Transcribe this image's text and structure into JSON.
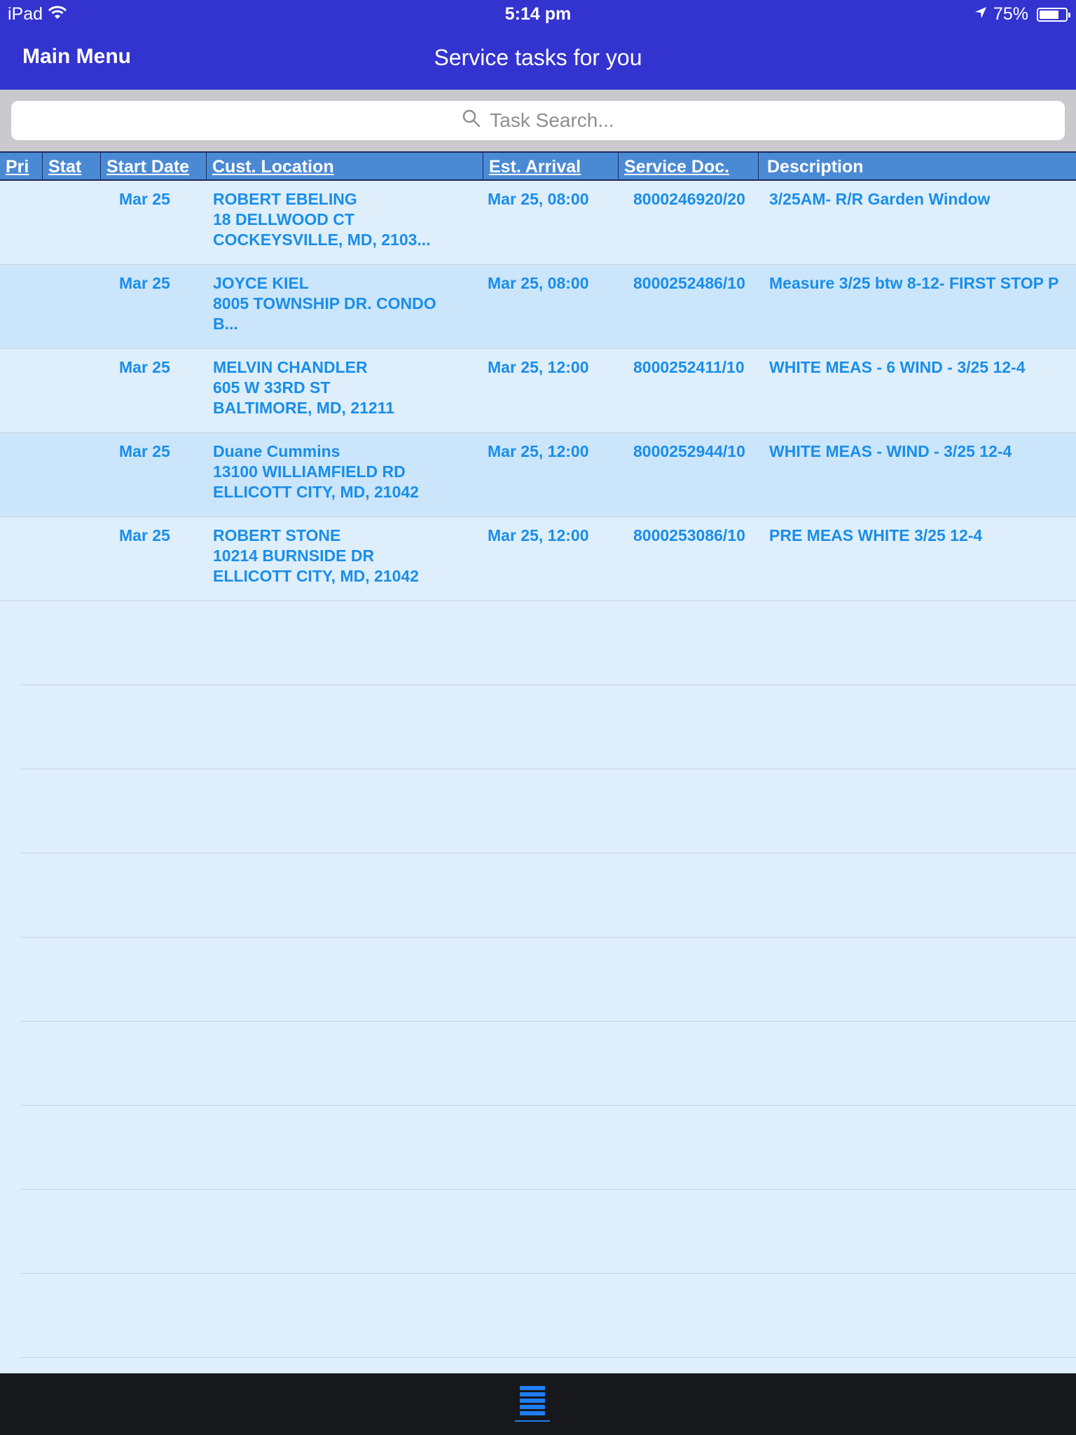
{
  "status_bar": {
    "device": "iPad",
    "time": "5:14 pm",
    "battery": "75%",
    "battery_level": 0.75
  },
  "nav": {
    "back_label": "Main Menu",
    "title": "Service tasks for you"
  },
  "search": {
    "placeholder": "Task Search..."
  },
  "table": {
    "headers": {
      "pri": "Pri",
      "stat": "Stat",
      "start_date": "Start Date",
      "location": "Cust. Location",
      "arrival": "Est. Arrival",
      "doc": "Service Doc.",
      "description": "Description"
    },
    "rows": [
      {
        "start_date": "Mar 25",
        "name": "ROBERT EBELING",
        "address1": "18 DELLWOOD CT",
        "address2": "COCKEYSVILLE, MD, 2103...",
        "arrival": "Mar 25, 08:00",
        "doc": "8000246920/20",
        "description": "3/25AM- R/R Garden Window"
      },
      {
        "start_date": "Mar 25",
        "name": "JOYCE KIEL",
        "address1": "8005 TOWNSHIP DR. CONDO",
        "address2": "B...",
        "arrival": "Mar 25, 08:00",
        "doc": "8000252486/10",
        "description": "Measure 3/25 btw 8-12- FIRST STOP P"
      },
      {
        "start_date": "Mar 25",
        "name": "MELVIN CHANDLER",
        "address1": "605 W 33RD ST",
        "address2": "BALTIMORE, MD, 21211",
        "arrival": "Mar 25, 12:00",
        "doc": "8000252411/10",
        "description": "WHITE MEAS - 6 WIND - 3/25 12-4"
      },
      {
        "start_date": "Mar 25",
        "name": "Duane Cummins",
        "address1": "13100 WILLIAMFIELD RD",
        "address2": "ELLICOTT CITY, MD, 21042",
        "arrival": "Mar 25, 12:00",
        "doc": "8000252944/10",
        "description": "WHITE MEAS - WIND - 3/25 12-4"
      },
      {
        "start_date": "Mar 25",
        "name": "ROBERT STONE",
        "address1": "10214 BURNSIDE DR",
        "address2": "ELLICOTT CITY, MD, 21042",
        "arrival": "Mar 25, 12:00",
        "doc": "8000253086/10",
        "description": "PRE MEAS WHITE 3/25 12-4"
      }
    ]
  },
  "tabbar": {
    "icon": "list-icon"
  },
  "colors": {
    "nav_bg": "#3333d0",
    "header_bg": "#4a8ad4",
    "row_bg": "#deeefb",
    "row_alt_bg": "#cbe5fb",
    "text_accent": "#1a8ee8",
    "tab_icon": "#1e7ef2"
  }
}
